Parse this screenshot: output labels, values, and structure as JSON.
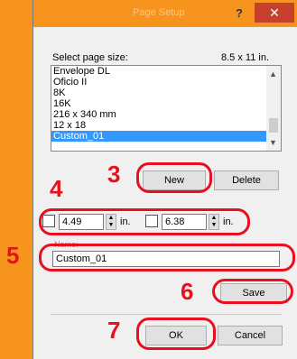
{
  "window": {
    "title": "Page Setup",
    "help_label": "?",
    "close_label": "✕"
  },
  "page_size": {
    "label": "Select page size:",
    "current_value": "8.5 x 11 in.",
    "items": [
      "Envelope DL",
      "Oficio II",
      "8K",
      "16K",
      "216 x 340 mm",
      "12 x 18",
      "Custom_01"
    ],
    "selected": "Custom_01"
  },
  "buttons": {
    "new": "New",
    "delete": "Delete",
    "save": "Save",
    "ok": "OK",
    "cancel": "Cancel"
  },
  "dimensions": {
    "width_value": "4.49",
    "height_value": "6.38",
    "unit": "in."
  },
  "name_field": {
    "label": "Name:",
    "value": "Custom_01"
  },
  "callouts": [
    "3",
    "4",
    "5",
    "6",
    "7"
  ],
  "colors": {
    "accent": "#f7941d",
    "highlight": "#e8101e",
    "selection": "#3399ff",
    "close": "#c7402e"
  },
  "icons": {
    "help": "help-icon",
    "close": "close-icon",
    "width": "width-arrow-icon",
    "height": "height-arrow-icon"
  }
}
